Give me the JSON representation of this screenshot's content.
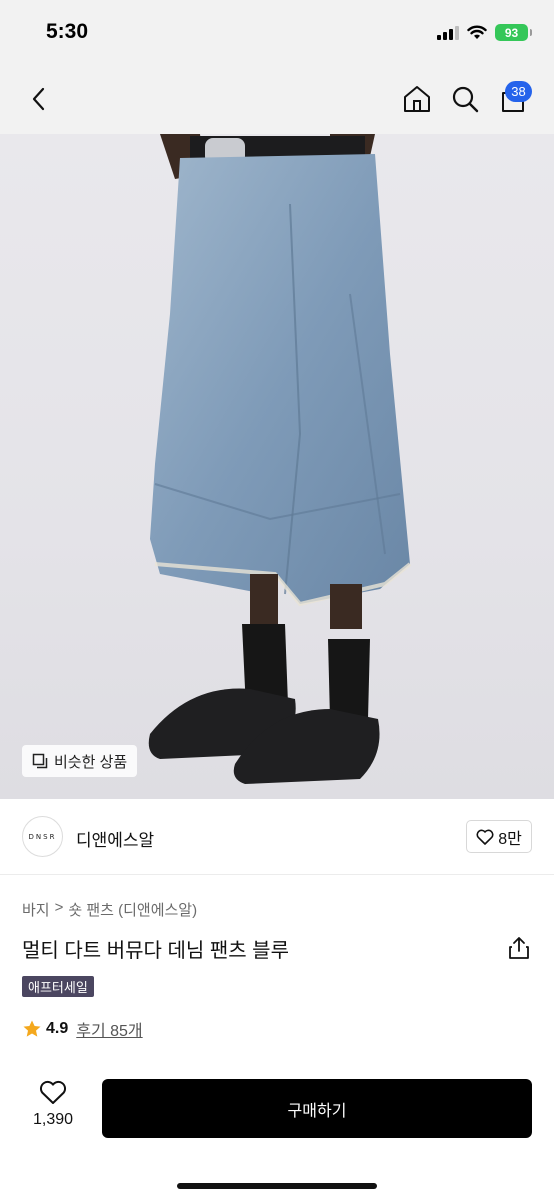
{
  "status": {
    "time": "5:30",
    "battery": "93",
    "icons": [
      "signal-icon",
      "wifi-icon",
      "battery-icon"
    ]
  },
  "nav": {
    "icons": [
      "chevron-left-icon",
      "home-icon",
      "search-icon",
      "cart-icon"
    ],
    "cart_count": "38"
  },
  "image": {
    "similar_label": "비슷한 상품",
    "icon": "copy-icon"
  },
  "brand": {
    "logo_text": "DNSR",
    "name": "디앤에스알",
    "likes": "8만",
    "icon": "heart-icon"
  },
  "product": {
    "breadcrumb": [
      "바지",
      "숏 팬츠 (디앤에스알)"
    ],
    "breadcrumb_separator": ">",
    "title": "멀티 다트 버뮤다 데님 팬츠 블루",
    "badge": "애프터세일",
    "rating": "4.9",
    "review_label": "후기 85개",
    "icons": [
      "share-icon",
      "star-icon"
    ]
  },
  "bottom": {
    "like_count": "1,390",
    "buy_label": "구매하기",
    "icons": [
      "heart-icon"
    ]
  },
  "colors": {
    "accent": "#2563eb",
    "badge": "#4b4660",
    "star": "#f4a81d",
    "buy": "#000000",
    "battery": "#35c759"
  }
}
